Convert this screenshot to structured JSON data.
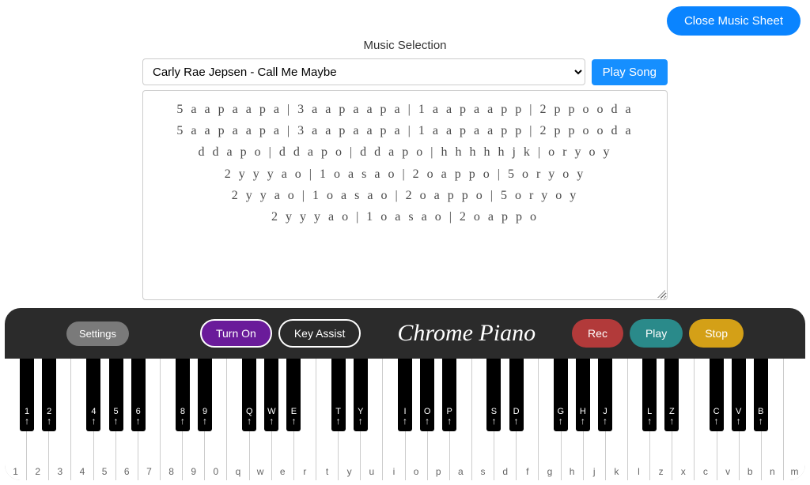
{
  "header": {
    "close_label": "Close Music Sheet",
    "section_title": "Music Selection",
    "play_song_label": "Play Song",
    "selected_song": "Carly Rae Jepsen - Call Me Maybe"
  },
  "sheet": {
    "lines": [
      "5 a a p a a p a | 3 a a p a a p a | 1 a a p a a p p | 2 p p o o d a",
      "5 a a p a a p a | 3 a a p a a p a | 1 a a p a a p p | 2 p p o o d a",
      "d d a p o | d d a p o | d d a p o | h h h h h j k | o r y o y",
      "2 y y y a o | 1 o a s a o | 2 o a p p o | 5 o r y o y",
      "2 y y a o | 1 o a s a o | 2 o a p p o | 5 o r y o y",
      "2 y y y a o | 1 o a s a o | 2 o a p p o"
    ]
  },
  "controls": {
    "settings": "Settings",
    "turn_on": "Turn On",
    "key_assist": "Key Assist",
    "title": "Chrome Piano",
    "rec": "Rec",
    "play": "Play",
    "stop": "Stop"
  },
  "white_keys": [
    "1",
    "2",
    "3",
    "4",
    "5",
    "6",
    "7",
    "8",
    "9",
    "0",
    "q",
    "w",
    "e",
    "r",
    "t",
    "y",
    "u",
    "i",
    "o",
    "p",
    "a",
    "s",
    "d",
    "f",
    "g",
    "h",
    "j",
    "k",
    "l",
    "z",
    "x",
    "c",
    "v",
    "b",
    "n",
    "m"
  ],
  "black_keys": [
    {
      "pos": 0,
      "label": "1"
    },
    {
      "pos": 1,
      "label": "2"
    },
    {
      "pos": 3,
      "label": "4"
    },
    {
      "pos": 4,
      "label": "5"
    },
    {
      "pos": 5,
      "label": "6"
    },
    {
      "pos": 7,
      "label": "8"
    },
    {
      "pos": 8,
      "label": "9"
    },
    {
      "pos": 10,
      "label": "Q"
    },
    {
      "pos": 11,
      "label": "W"
    },
    {
      "pos": 12,
      "label": "E"
    },
    {
      "pos": 14,
      "label": "T"
    },
    {
      "pos": 15,
      "label": "Y"
    },
    {
      "pos": 17,
      "label": "I"
    },
    {
      "pos": 18,
      "label": "O"
    },
    {
      "pos": 19,
      "label": "P"
    },
    {
      "pos": 21,
      "label": "S"
    },
    {
      "pos": 22,
      "label": "D"
    },
    {
      "pos": 24,
      "label": "G"
    },
    {
      "pos": 25,
      "label": "H"
    },
    {
      "pos": 26,
      "label": "J"
    },
    {
      "pos": 28,
      "label": "L"
    },
    {
      "pos": 29,
      "label": "Z"
    },
    {
      "pos": 31,
      "label": "C"
    },
    {
      "pos": 32,
      "label": "V"
    },
    {
      "pos": 33,
      "label": "B"
    }
  ],
  "colors": {
    "accent_blue": "#0a84ff",
    "accent_purple": "#6a1b9a",
    "accent_red": "#b23a3a",
    "accent_teal": "#2a8a8a",
    "accent_gold": "#d4a017"
  }
}
